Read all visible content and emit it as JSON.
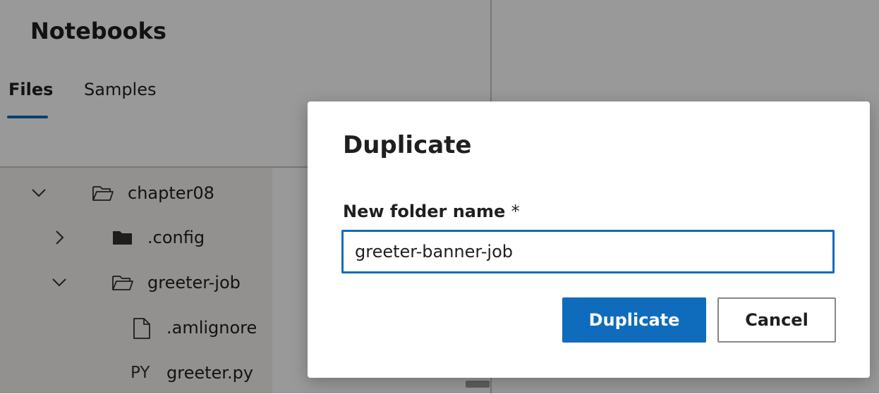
{
  "panel": {
    "title": "Notebooks"
  },
  "tabs": [
    {
      "label": "Files",
      "selected": true
    },
    {
      "label": "Samples",
      "selected": false
    }
  ],
  "tree": [
    {
      "label": "chapter08",
      "type": "folder",
      "expanded": true,
      "icon": "folder-open-icon"
    },
    {
      "label": ".config",
      "type": "folder",
      "expanded": false,
      "icon": "folder-closed-icon"
    },
    {
      "label": "greeter-job",
      "type": "folder",
      "expanded": true,
      "icon": "folder-open-icon"
    },
    {
      "label": ".amlignore",
      "type": "file",
      "icon": "file-icon"
    },
    {
      "label": "greeter.py",
      "type": "file",
      "icon": "python-file-icon",
      "badge": "PY"
    }
  ],
  "dialog": {
    "title": "Duplicate",
    "field_label": "New folder name",
    "required_marker": "*",
    "field_value": "greeter-banner-job",
    "primary_button": "Duplicate",
    "secondary_button": "Cancel"
  },
  "colors": {
    "accent": "#0f6cbd",
    "overlay": "rgba(0,0,0,0.4)"
  }
}
